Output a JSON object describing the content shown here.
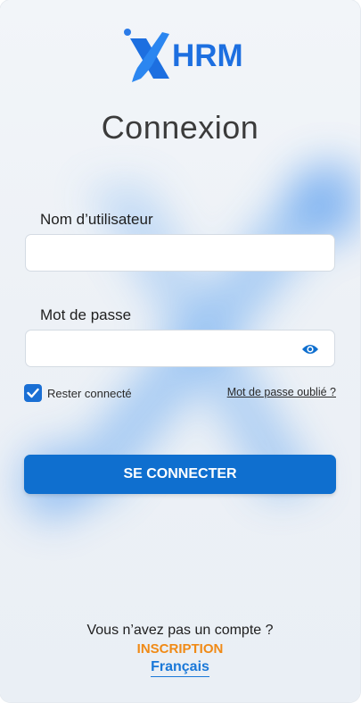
{
  "brand": {
    "logo_text": "HRM",
    "colors": {
      "primary": "#0f6fcf",
      "accent": "#f08a16",
      "link": "#1a78d8"
    }
  },
  "page": {
    "title": "Connexion"
  },
  "form": {
    "username": {
      "label": "Nom d’utilisateur",
      "value": "",
      "placeholder": ""
    },
    "password": {
      "label": "Mot de passe",
      "value": "",
      "placeholder": "",
      "toggle_icon": "eye-icon"
    },
    "remember_me": {
      "label": "Rester connecté",
      "checked": true
    },
    "forgot_password_label": "Mot de passe oublié ?",
    "submit_label": "SE CONNECTER"
  },
  "footer": {
    "no_account_text": "Vous n’avez pas un compte ?",
    "signup_label": "INSCRIPTION",
    "language_label": "Français"
  }
}
